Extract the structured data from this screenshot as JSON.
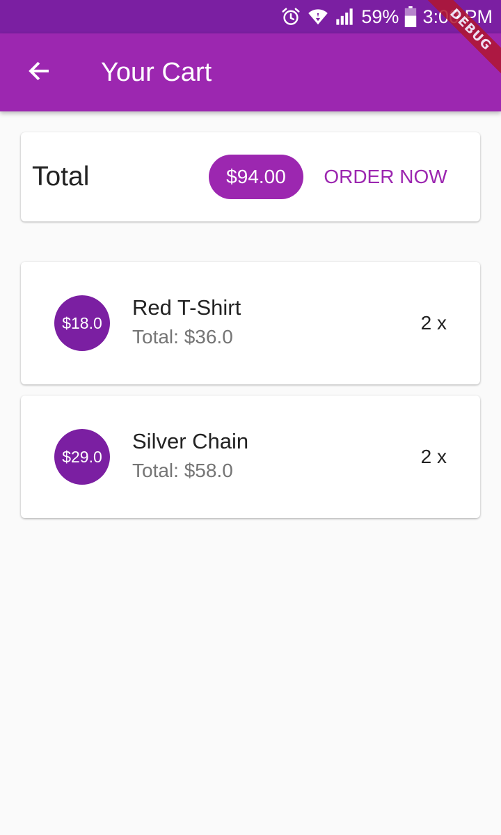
{
  "status_bar": {
    "battery": "59%",
    "time": "3:00 PM",
    "icons": [
      "alarm-icon",
      "wifi-icon",
      "signal-icon",
      "battery-icon"
    ]
  },
  "debug_banner": "DEBUG",
  "app_bar": {
    "back_icon": "arrow-back-icon",
    "title": "Your Cart",
    "color": "#9c27b0"
  },
  "summary": {
    "label": "Total",
    "amount": "$94.00",
    "order_button": "ORDER NOW"
  },
  "cart_items": [
    {
      "price": "$18.0",
      "title": "Red T-Shirt",
      "subtitle": "Total: $36.0",
      "quantity": "2 x"
    },
    {
      "price": "$29.0",
      "title": "Silver Chain",
      "subtitle": "Total: $58.0",
      "quantity": "2 x"
    }
  ],
  "colors": {
    "primary": "#9c27b0",
    "primary_dark": "#7b1fa2",
    "background": "#fafafa",
    "secondary_text": "#757575"
  }
}
